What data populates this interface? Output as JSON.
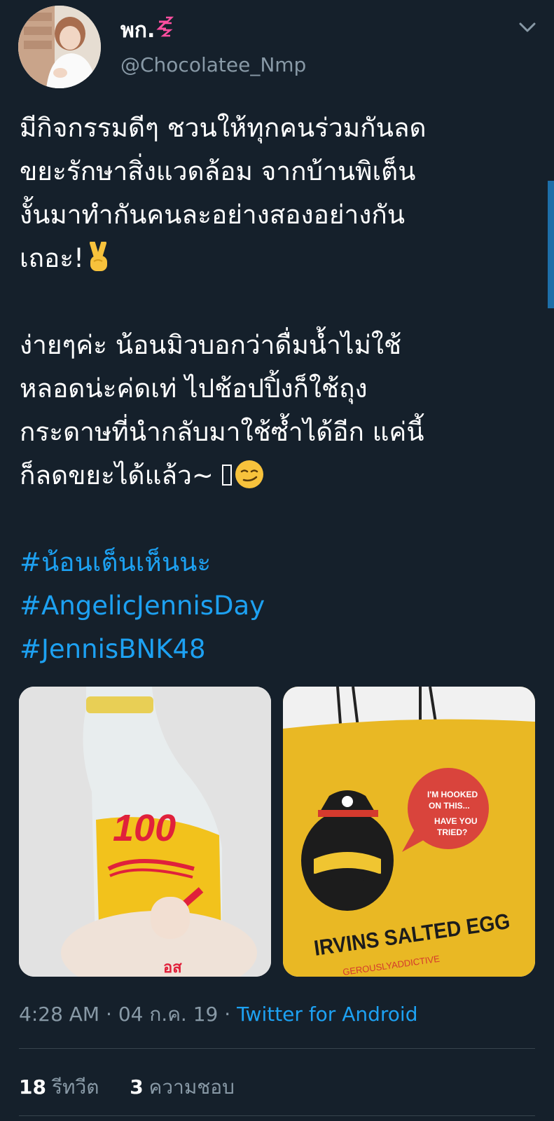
{
  "user": {
    "display_name": "พก.",
    "name_badge": "zzz",
    "handle": "@Chocolatee_Nmp"
  },
  "tweet": {
    "lines": [
      "มีกิจกรรมดีๆ ชวนให้ทุกคนร่วมกันลด",
      "ขยะรักษาสิ่งแวดล้อม จากบ้านพิเต็น",
      "งั้นมาทำกันคนละอย่างสองอย่างกัน",
      "เถอะ!",
      "ง่ายๆค่ะ น้อนมิวบอกว่าดื่มน้ำไม่ใช้",
      "หลอดน่ะค่ดเท่ ไปช้อปปิ้งก็ใช้ถุง",
      "กระดาษที่นำกลับมาใช้ซ้ำได้อีก แค่นี้",
      "ก็ลดขยะได้แล้ว~"
    ],
    "hashtags": [
      "#น้อนเต็นเห็นนะ",
      "#AngelicJennisDay",
      "#JennisBNK48"
    ],
    "emojis": [
      "victory-hand",
      "smirking-face"
    ]
  },
  "media": {
    "left": {
      "printed_text": "100",
      "label_fragment": "อส"
    },
    "right": {
      "bubble_line1": "I'M HOOKED",
      "bubble_line2": "ON THIS...",
      "bubble_line3": "HAVE YOU",
      "bubble_line4": "TRIED?",
      "brand": "IRVINS SALTED EGG",
      "tagline": "GEROUSLYADDICTIVE"
    }
  },
  "meta": {
    "time": "4:28 AM",
    "separator": "·",
    "date": "04 ก.ค. 19",
    "app": "Twitter for Android"
  },
  "stats": {
    "retweets_count": "18",
    "retweets_label": "รีทวีต",
    "likes_count": "3",
    "likes_label": "ความชอบ"
  },
  "colors": {
    "background": "#15202b",
    "link": "#1da1f2",
    "secondary_text": "#8899a6",
    "divider": "#38444d"
  }
}
